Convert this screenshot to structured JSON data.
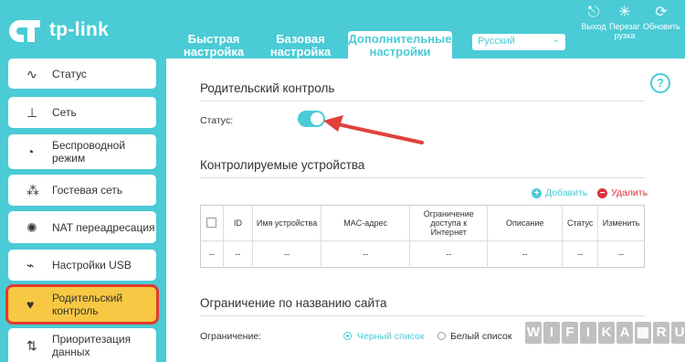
{
  "logo": {
    "text": "tp-link"
  },
  "tabs": [
    {
      "label": "Быстрая настройка"
    },
    {
      "label": "Базовая настройка"
    },
    {
      "label": "Дополнительные настройки"
    }
  ],
  "language": {
    "value": "Русский"
  },
  "top_icons": [
    {
      "label": "Выход",
      "icon": "logout-icon"
    },
    {
      "label": "Перезагрузка",
      "icon": "reboot-icon"
    },
    {
      "label": "Обновить",
      "icon": "update-icon"
    }
  ],
  "sidebar": {
    "items": [
      {
        "label": "Статус",
        "icon": "pulse-icon"
      },
      {
        "label": "Сеть",
        "icon": "network-icon"
      },
      {
        "label": "Беспроводной режим",
        "icon": "wifi-icon"
      },
      {
        "label": "Гостевая сеть",
        "icon": "guest-icon"
      },
      {
        "label": "NAT переадресация",
        "icon": "nat-icon"
      },
      {
        "label": "Настройки USB",
        "icon": "usb-icon"
      },
      {
        "label": "Родительский контроль",
        "icon": "heart-icon",
        "active": true
      },
      {
        "label": "Приоритезация данных",
        "icon": "priority-icon"
      }
    ]
  },
  "main": {
    "title": "Родительский контроль",
    "status_label": "Статус:",
    "status_on": true,
    "devices_title": "Контролируемые устройства",
    "add_label": "Добавить",
    "delete_label": "Удалить",
    "table": {
      "headers": [
        "ID",
        "Имя устройства",
        "MAC-адрес",
        "Ограничение доступа к Интернет",
        "Описание",
        "Статус",
        "Изменить"
      ],
      "row": [
        "--",
        "--",
        "--",
        "--",
        "--",
        "--",
        "--",
        "--"
      ]
    },
    "site_restrict_title": "Ограничение по названию сайта",
    "restriction_label": "Ограничение:",
    "blacklist_label": "Черный список",
    "whitelist_label": "Белый список",
    "selected": "Черный список"
  },
  "watermark": [
    "W",
    "I",
    "F",
    "I",
    "K",
    "A",
    "▦",
    "R",
    "U"
  ],
  "colors": {
    "accent": "#4acbd6",
    "active_item": "#f7c843",
    "highlight_ring": "#e33b2e",
    "delete": "#d9363e",
    "arrow": "#e0413a"
  }
}
